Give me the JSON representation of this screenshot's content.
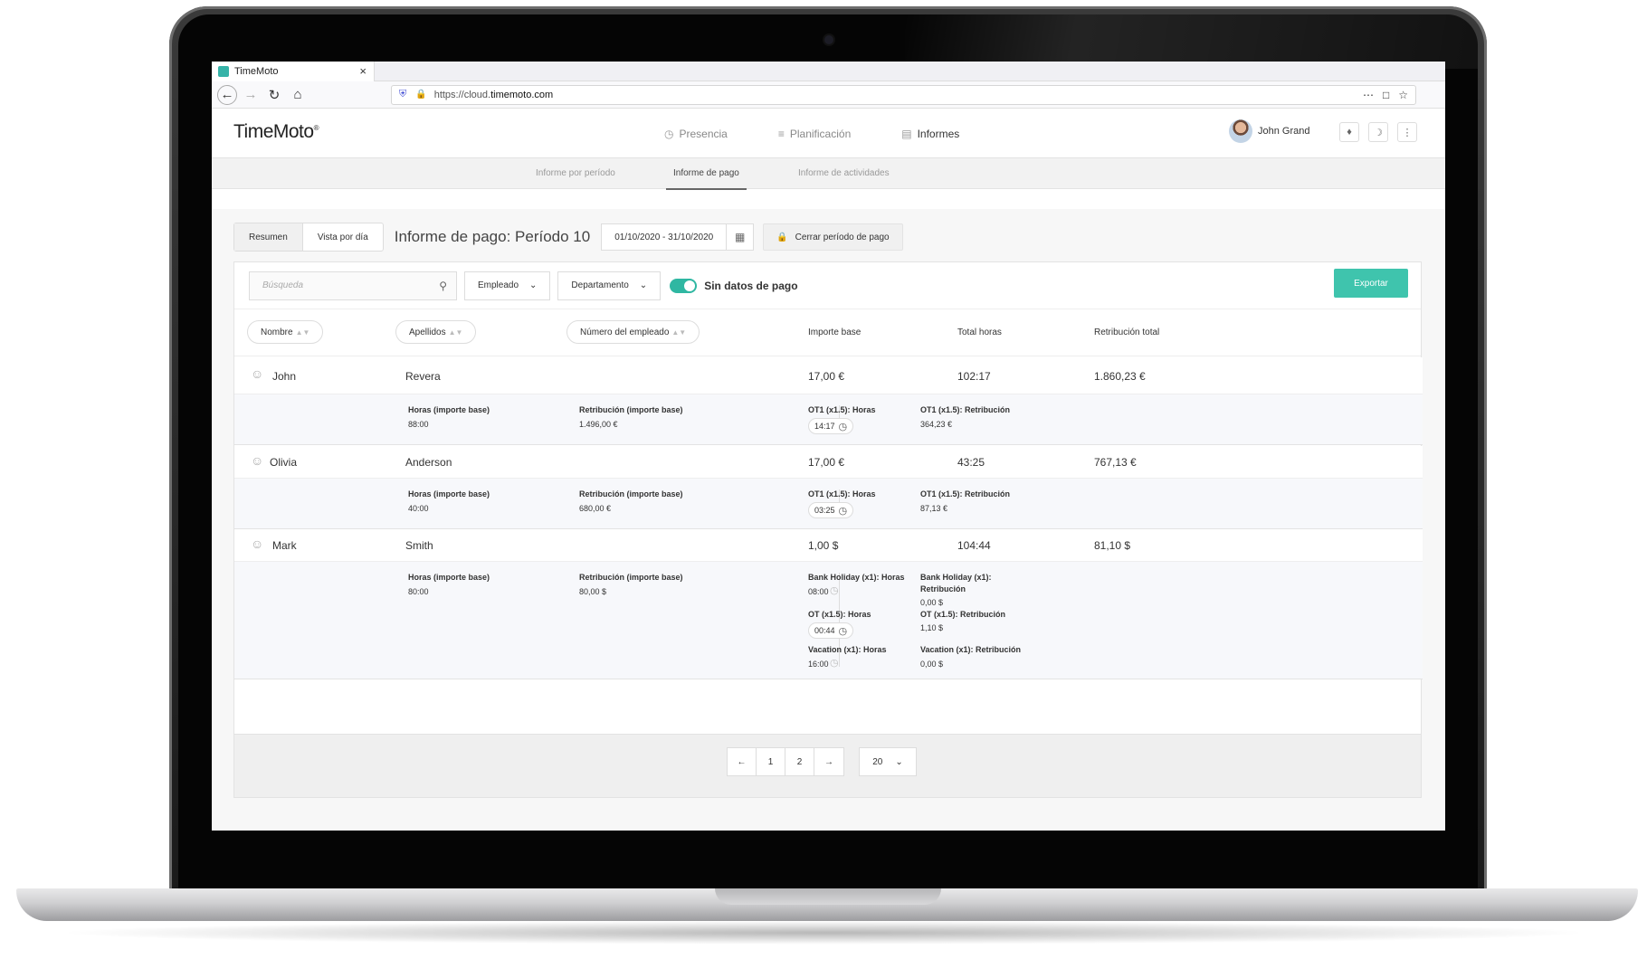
{
  "browser": {
    "tab_title": "TimeMoto",
    "tab_close": "×",
    "url_prefix": "https://cloud.",
    "url_domain": "timemoto.com"
  },
  "header": {
    "logo": "TimeMoto",
    "nav": [
      {
        "label": "Presencia",
        "icon": "clock-icon"
      },
      {
        "label": "Planificación",
        "icon": "sliders-icon"
      },
      {
        "label": "Informes",
        "icon": "document-icon"
      }
    ],
    "user_name": "John Grand"
  },
  "subtabs": [
    "Informe por período",
    "Informe de pago",
    "Informe de actividades"
  ],
  "toolbar": {
    "view_summary": "Resumen",
    "view_daily": "Vista por día",
    "title": "Informe de pago: Período 10",
    "date_range": "01/10/2020 - 31/10/2020",
    "close_period": "Cerrar período de pago"
  },
  "filters": {
    "search_placeholder": "Búsqueda",
    "employee": "Empleado",
    "department": "Departamento",
    "toggle_label": "Sin datos de pago",
    "toggle_on": true,
    "export": "Exportar"
  },
  "columns": {
    "first_name": "Nombre",
    "last_name": "Apellidos",
    "employee_number": "Número del empleado",
    "base_amount": "Importe base",
    "total_hours": "Total horas",
    "total_pay": "Retribución total"
  },
  "employees": [
    {
      "first": "John",
      "last": "Revera",
      "base": "17,00 €",
      "hours": "102:17",
      "total": "1.860,23 €",
      "base_hours_label": "Horas (importe base)",
      "base_hours": "88:00",
      "base_pay_label": "Retribución (importe base)",
      "base_pay": "1.496,00 €",
      "extra": [
        {
          "h_label": "OT1 (x1.5): Horas",
          "h_value": "14:17",
          "p_label": "OT1 (x1.5): Retribución",
          "p_value": "364,23 €"
        }
      ]
    },
    {
      "first": "Olivia",
      "last": "Anderson",
      "base": "17,00 €",
      "hours": "43:25",
      "total": "767,13 €",
      "base_hours_label": "Horas (importe base)",
      "base_hours": "40:00",
      "base_pay_label": "Retribución (importe base)",
      "base_pay": "680,00 €",
      "extra": [
        {
          "h_label": "OT1 (x1.5): Horas",
          "h_value": "03:25",
          "p_label": "OT1 (x1.5): Retribución",
          "p_value": "87,13 €"
        }
      ]
    },
    {
      "first": "Mark",
      "last": "Smith",
      "base": "1,00 $",
      "hours": "104:44",
      "total": "81,10 $",
      "base_hours_label": "Horas (importe base)",
      "base_hours": "80:00",
      "base_pay_label": "Retribución (importe base)",
      "base_pay": "80,00 $",
      "extra": [
        {
          "h_label": "Bank Holiday (x1): Horas",
          "h_value": "08:00",
          "p_label_1": "Bank Holiday (x1):",
          "p_label_2": "Retribución",
          "p_value": "0,00 $"
        },
        {
          "h_label": "OT (x1.5): Horas",
          "h_value": "00:44",
          "p_label": "OT (x1.5): Retribución",
          "p_value": "1,10 $"
        },
        {
          "h_label": "Vacation (x1): Horas",
          "h_value": "16:00",
          "p_label": "Vacation (x1): Retribución",
          "p_value": "0,00 $"
        }
      ]
    }
  ],
  "pagination": {
    "prev": "←",
    "pages": [
      "1",
      "2"
    ],
    "next": "→",
    "per_page": "20"
  },
  "colors": {
    "accent": "#3fc4ad",
    "toggle": "#2fb7a2"
  }
}
